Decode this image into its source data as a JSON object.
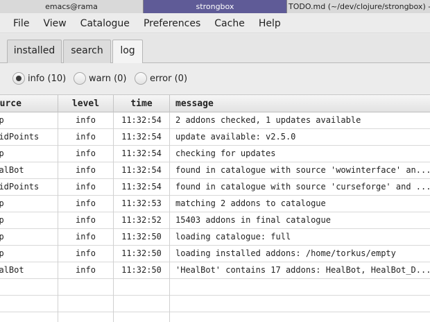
{
  "wm": {
    "tabs": [
      "emacs@rama",
      "strongbox",
      "TODO.md (~/dev/clojure/strongbox) - Plu..."
    ]
  },
  "menu": [
    "File",
    "View",
    "Catalogue",
    "Preferences",
    "Cache",
    "Help"
  ],
  "tabs": [
    {
      "label": "installed"
    },
    {
      "label": "search"
    },
    {
      "label": "log",
      "active": true
    }
  ],
  "filters": [
    {
      "label": "info (10)",
      "selected": true
    },
    {
      "label": "warn (0)",
      "selected": false
    },
    {
      "label": "error (0)",
      "selected": false
    }
  ],
  "table": {
    "columns": [
      "source",
      "level",
      "time",
      "message"
    ],
    "rows": [
      {
        "source": "app",
        "level": "info",
        "time": "11:32:54",
        "message": "2 addons checked, 1 updates available"
      },
      {
        "source": "RaidPoints",
        "level": "info",
        "time": "11:32:54",
        "message": "update available: v2.5.0"
      },
      {
        "source": "app",
        "level": "info",
        "time": "11:32:54",
        "message": "checking for updates"
      },
      {
        "source": "HealBot",
        "level": "info",
        "time": "11:32:54",
        "message": "found in catalogue with source 'wowinterface' an..."
      },
      {
        "source": "RaidPoints",
        "level": "info",
        "time": "11:32:54",
        "message": "found in catalogue with source 'curseforge' and ..."
      },
      {
        "source": "app",
        "level": "info",
        "time": "11:32:53",
        "message": "matching 2 addons to catalogue"
      },
      {
        "source": "app",
        "level": "info",
        "time": "11:32:52",
        "message": "15403 addons in final catalogue"
      },
      {
        "source": "app",
        "level": "info",
        "time": "11:32:50",
        "message": "loading catalogue: full"
      },
      {
        "source": "app",
        "level": "info",
        "time": "11:32:50",
        "message": "loading installed addons: /home/torkus/empty"
      },
      {
        "source": "HealBot",
        "level": "info",
        "time": "11:32:50",
        "message": "'HealBot' contains 17 addons: HealBot, HealBot_D..."
      }
    ],
    "empty_rows": 3
  }
}
